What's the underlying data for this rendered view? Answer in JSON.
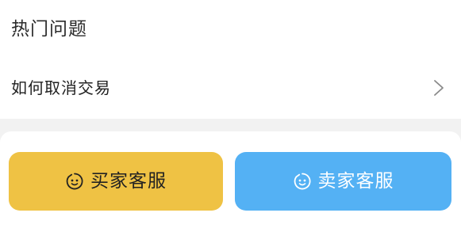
{
  "faq": {
    "section_title": "热门问题",
    "items": [
      {
        "label": "如何取消交易"
      }
    ]
  },
  "service_buttons": {
    "buyer": {
      "label": "买家客服",
      "icon": "smiley-face-icon",
      "color": "#efc244"
    },
    "seller": {
      "label": "卖家客服",
      "icon": "smiley-face-icon",
      "color": "#54b1f4"
    }
  }
}
